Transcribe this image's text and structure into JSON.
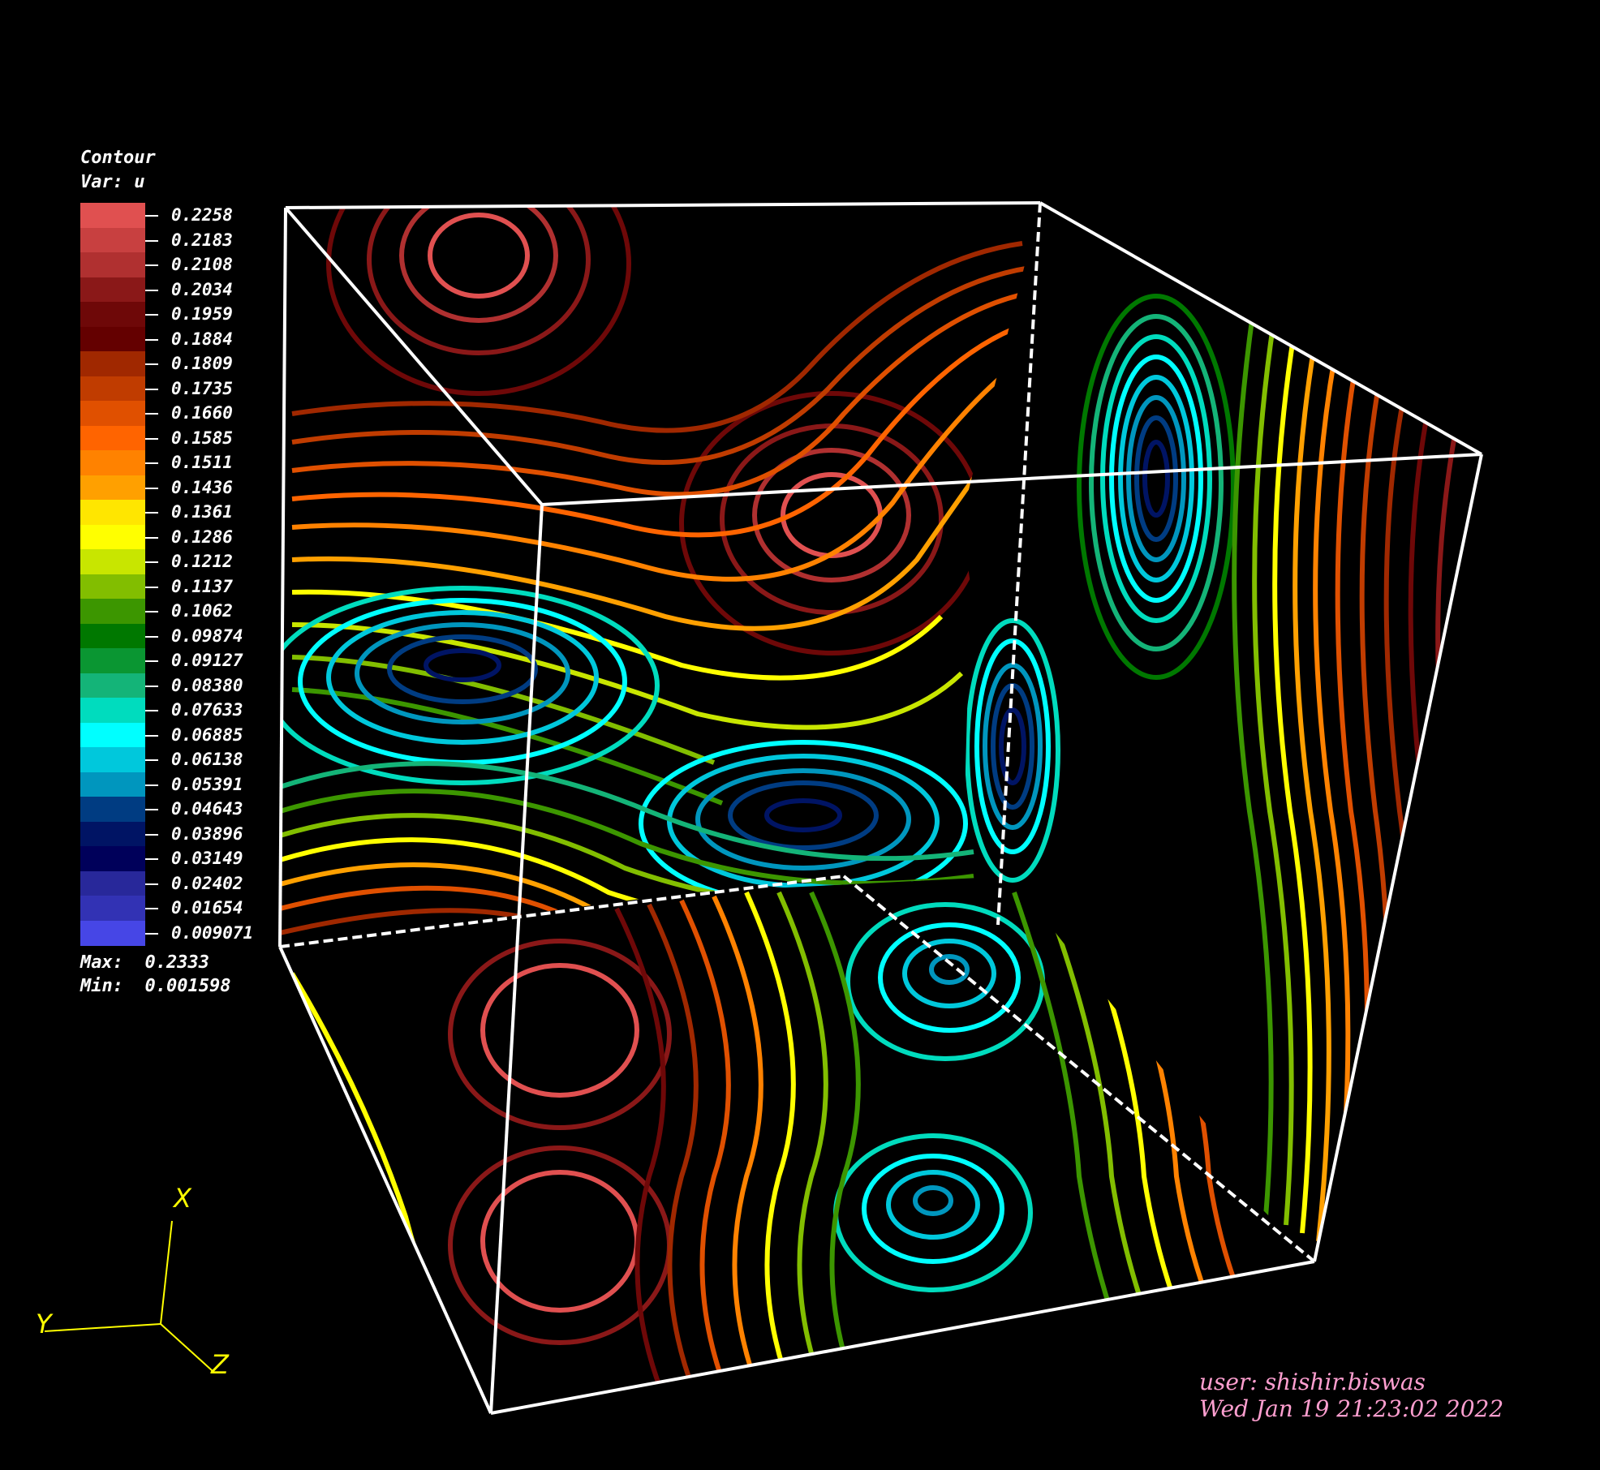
{
  "legend": {
    "plot_type": "Contour",
    "var_label": "Var: u",
    "levels": [
      "0.2258",
      "0.2183",
      "0.2108",
      "0.2034",
      "0.1959",
      "0.1884",
      "0.1809",
      "0.1735",
      "0.1660",
      "0.1585",
      "0.1511",
      "0.1436",
      "0.1361",
      "0.1286",
      "0.1212",
      "0.1137",
      "0.1062",
      "0.09874",
      "0.09127",
      "0.08380",
      "0.07633",
      "0.06885",
      "0.06138",
      "0.05391",
      "0.04643",
      "0.03896",
      "0.03149",
      "0.02402",
      "0.01654",
      "0.009071"
    ],
    "colors": [
      "#e05050",
      "#c84040",
      "#b03030",
      "#8a1818",
      "#6e0808",
      "#640000",
      "#a02800",
      "#c03c00",
      "#e05000",
      "#ff6400",
      "#ff8200",
      "#ffa000",
      "#ffe600",
      "#ffff00",
      "#c8e600",
      "#82be00",
      "#3c9600",
      "#007800",
      "#0a9632",
      "#14b478",
      "#00dcbe",
      "#00ffff",
      "#00c8dc",
      "#0096be",
      "#003c82",
      "#001464",
      "#00005a",
      "#28289a",
      "#3232b4",
      "#4646e6"
    ],
    "max_label": "Max:",
    "max_value": "0.2333",
    "min_label": "Min:",
    "min_value": "0.001598"
  },
  "axes": {
    "x": "X",
    "y": "Y",
    "z": "Z"
  },
  "user": "user: shishir.biswas",
  "timestamp": "Wed Jan 19 21:23:02 2022"
}
